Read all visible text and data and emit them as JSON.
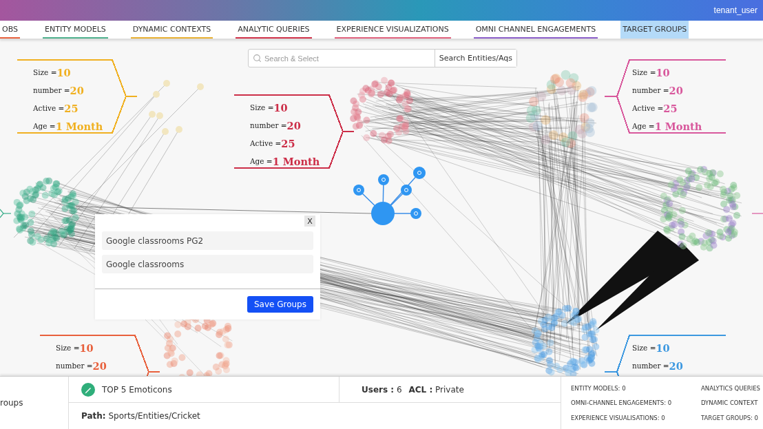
{
  "header": {
    "user": "tenant_user"
  },
  "tabs": [
    {
      "label": "OBS",
      "selected": false,
      "color": "#e8603c"
    },
    {
      "label": "ENTITY MODELS",
      "selected": false,
      "color": "#4cb08c"
    },
    {
      "label": "DYNAMIC CONTEXTS",
      "selected": false,
      "color": "#e8b030"
    },
    {
      "label": "ANALYTIC QUERIES",
      "selected": false,
      "color": "#d03048"
    },
    {
      "label": "EXPERIENCE VISUALIZATIONS",
      "selected": false,
      "color": "#e0607c"
    },
    {
      "label": "OMNI CHANNEL ENGAGEMENTS",
      "selected": false,
      "color": "#8a5cc8"
    },
    {
      "label": "TARGET GROUPS",
      "selected": true,
      "color": "#b4daf8"
    }
  ],
  "search": {
    "placeholder": "Search & Select",
    "button": "Search Entities/Aqs"
  },
  "callouts": [
    {
      "kind": "point-right",
      "color": "#f0b020",
      "rows": [
        {
          "label": "Size =",
          "value": "10"
        },
        {
          "label": "number =",
          "value": "20"
        },
        {
          "label": "Active =",
          "value": "25"
        },
        {
          "label": "Age =",
          "value": "1 Month"
        }
      ]
    },
    {
      "kind": "point-right",
      "color": "#cc2e48",
      "rows": [
        {
          "label": "Size =",
          "value": "10"
        },
        {
          "label": "number =",
          "value": "20"
        },
        {
          "label": "Active =",
          "value": "25"
        },
        {
          "label": "Age =",
          "value": "1 Month"
        }
      ]
    },
    {
      "kind": "point-left",
      "color": "#d8589c",
      "rows": [
        {
          "label": "Size =",
          "value": "10"
        },
        {
          "label": "number =",
          "value": "20"
        },
        {
          "label": "Active =",
          "value": "25"
        },
        {
          "label": "Age =",
          "value": "1 Month"
        }
      ]
    },
    {
      "kind": "point-right",
      "color": "#e8603c",
      "rows": [
        {
          "label": "Size =",
          "value": "10"
        },
        {
          "label": "number =",
          "value": "20"
        }
      ]
    },
    {
      "kind": "point-left",
      "color": "#3c98e0",
      "rows": [
        {
          "label": "Size =",
          "value": "10"
        },
        {
          "label": "number =",
          "value": "20"
        }
      ]
    }
  ],
  "dialog": {
    "close": "X",
    "groups": [
      "Google classrooms PG2",
      "Google classrooms"
    ],
    "button": "Save Groups"
  },
  "footer": {
    "left": "roups",
    "title": "TOP 5 Emoticons",
    "users": "**Users :** 6",
    "acl": "**ACL :** Private",
    "path": "**Path:** Sports/Entities/Cricket",
    "counts": [
      "ENTITY MODELS: 0",
      "ANALYTICS QUERIES",
      "OMNI-CHANNEL ENGAGEMENTS: 0",
      "DYNAMIC CONTEXT",
      "EXPERIENCE VISUALISATIONS: 0",
      "TARGET GROUPS: 0"
    ]
  }
}
